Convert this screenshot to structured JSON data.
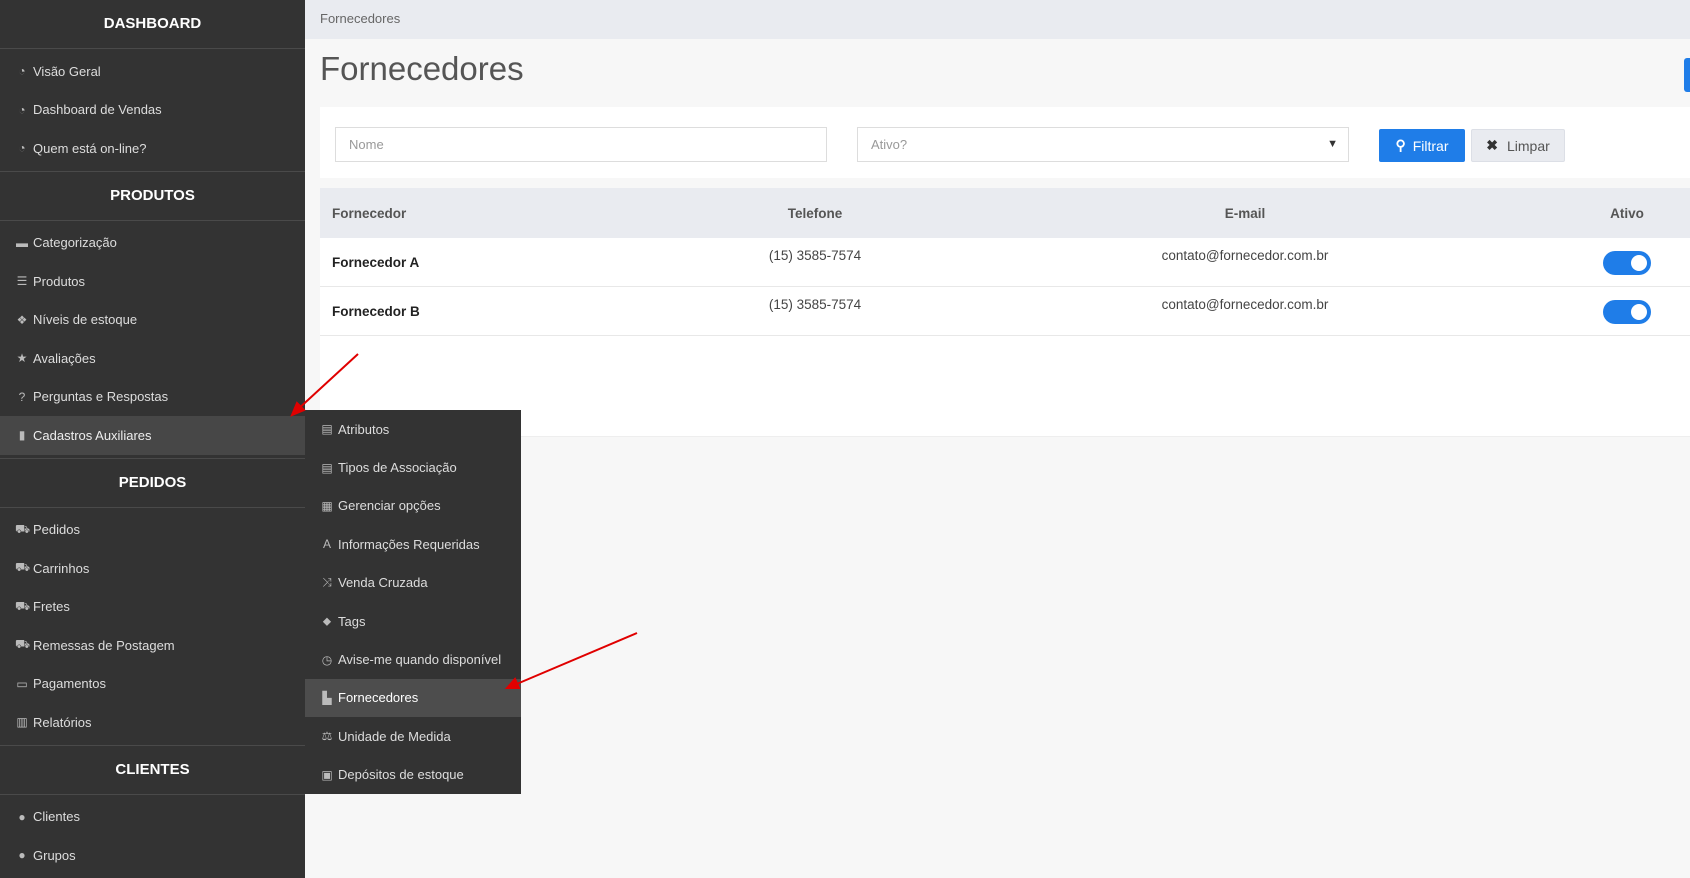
{
  "sidebar": {
    "sections": [
      {
        "title": "DASHBOARD",
        "items": [
          {
            "label": "Visão Geral",
            "icon": "tachometer-icon",
            "glyph": "◔"
          },
          {
            "label": "Dashboard de Vendas",
            "icon": "tachometer-icon",
            "glyph": "◔"
          },
          {
            "label": "Quem está on-line?",
            "icon": "tachometer-icon",
            "glyph": "◔"
          }
        ]
      },
      {
        "title": "PRODUTOS",
        "items": [
          {
            "label": "Categorização",
            "icon": "folder-icon",
            "glyph": "▬"
          },
          {
            "label": "Produtos",
            "icon": "list-icon",
            "glyph": "☰"
          },
          {
            "label": "Níveis de estoque",
            "icon": "cubes-icon",
            "glyph": "❖"
          },
          {
            "label": "Avaliações",
            "icon": "star-icon",
            "glyph": "★"
          },
          {
            "label": "Perguntas e Respostas",
            "icon": "question-circle-icon",
            "glyph": "?"
          },
          {
            "label": "Cadastros Auxiliares",
            "icon": "file-icon",
            "glyph": "▮",
            "active": true
          }
        ]
      },
      {
        "title": "PEDIDOS",
        "items": [
          {
            "label": "Pedidos",
            "icon": "cart-icon",
            "glyph": "⛟"
          },
          {
            "label": "Carrinhos",
            "icon": "cart-icon",
            "glyph": "⛟"
          },
          {
            "label": "Fretes",
            "icon": "truck-icon",
            "glyph": "⛟"
          },
          {
            "label": "Remessas de Postagem",
            "icon": "truck-icon",
            "glyph": "⛟"
          },
          {
            "label": "Pagamentos",
            "icon": "credit-card-icon",
            "glyph": "▭"
          },
          {
            "label": "Relatórios",
            "icon": "bar-chart-icon",
            "glyph": "▥"
          }
        ]
      },
      {
        "title": "CLIENTES",
        "items": [
          {
            "label": "Clientes",
            "icon": "user-icon",
            "glyph": "●"
          },
          {
            "label": "Grupos",
            "icon": "users-icon",
            "glyph": "●"
          }
        ]
      }
    ]
  },
  "submenu": {
    "items": [
      {
        "label": "Atributos",
        "icon": "list-alt-icon",
        "glyph": "▤"
      },
      {
        "label": "Tipos de Associação",
        "icon": "server-icon",
        "glyph": "▤"
      },
      {
        "label": "Gerenciar opções",
        "icon": "th-icon",
        "glyph": "▦"
      },
      {
        "label": "Informações Requeridas",
        "icon": "font-icon",
        "glyph": "A"
      },
      {
        "label": "Venda Cruzada",
        "icon": "random-icon",
        "glyph": "⤨"
      },
      {
        "label": "Tags",
        "icon": "tags-icon",
        "glyph": "⬥"
      },
      {
        "label": "Avise-me quando disponível",
        "icon": "clock-icon",
        "glyph": "◷"
      },
      {
        "label": "Fornecedores",
        "icon": "industry-icon",
        "glyph": "▙",
        "active": true
      },
      {
        "label": "Unidade de Medida",
        "icon": "balance-scale-icon",
        "glyph": "⚖"
      },
      {
        "label": "Depósitos de estoque",
        "icon": "archive-icon",
        "glyph": "▣"
      }
    ]
  },
  "breadcrumb": "Fornecedores",
  "page": {
    "title": "Fornecedores"
  },
  "filter": {
    "name_placeholder": "Nome",
    "active_placeholder": "Ativo?",
    "filter_label": "Filtrar",
    "clear_label": "Limpar"
  },
  "table": {
    "headers": [
      "Fornecedor",
      "Telefone",
      "E-mail",
      "Ativo"
    ],
    "rows": [
      {
        "name": "Fornecedor A",
        "phone": "(15) 3585-7574",
        "email": "contato@fornecedor.com.br",
        "active": true
      },
      {
        "name": "Fornecedor B",
        "phone": "(15) 3585-7574",
        "email": "contato@fornecedor.com.br",
        "active": true
      }
    ]
  },
  "colors": {
    "accent": "#1f7de8",
    "sidebar": "#333333",
    "annotation": "#e00000"
  }
}
